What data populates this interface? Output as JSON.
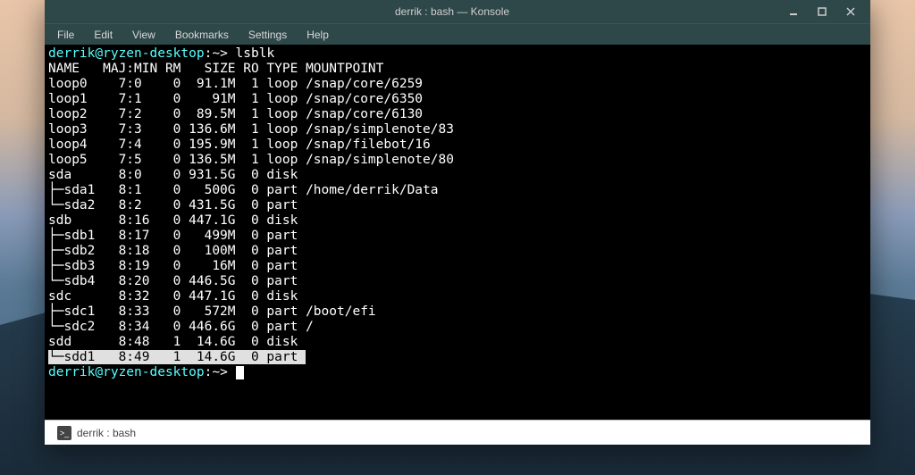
{
  "titlebar": {
    "title": "derrik : bash — Konsole"
  },
  "menubar": {
    "file": "File",
    "edit": "Edit",
    "view": "View",
    "bookmarks": "Bookmarks",
    "settings": "Settings",
    "help": "Help"
  },
  "terminal": {
    "prompt1_user": "derrik@ryzen-desktop",
    "prompt1_path": ":~>",
    "command1": " lsblk",
    "header": "NAME   MAJ:MIN RM   SIZE RO TYPE MOUNTPOINT",
    "lines": [
      "loop0    7:0    0  91.1M  1 loop /snap/core/6259",
      "loop1    7:1    0    91M  1 loop /snap/core/6350",
      "loop2    7:2    0  89.5M  1 loop /snap/core/6130",
      "loop3    7:3    0 136.6M  1 loop /snap/simplenote/83",
      "loop4    7:4    0 195.9M  1 loop /snap/filebot/16",
      "loop5    7:5    0 136.5M  1 loop /snap/simplenote/80",
      "sda      8:0    0 931.5G  0 disk ",
      "├─sda1   8:1    0   500G  0 part /home/derrik/Data",
      "└─sda2   8:2    0 431.5G  0 part ",
      "sdb      8:16   0 447.1G  0 disk ",
      "├─sdb1   8:17   0   499M  0 part ",
      "├─sdb2   8:18   0   100M  0 part ",
      "├─sdb3   8:19   0    16M  0 part ",
      "└─sdb4   8:20   0 446.5G  0 part ",
      "sdc      8:32   0 447.1G  0 disk ",
      "├─sdc1   8:33   0   572M  0 part /boot/efi",
      "└─sdc2   8:34   0 446.6G  0 part /",
      "sdd      8:48   1  14.6G  0 disk "
    ],
    "highlighted_line": "└─sdd1   8:49   1  14.6G  0 part ",
    "prompt2_user": "derrik@ryzen-desktop",
    "prompt2_path": ":~>"
  },
  "tab": {
    "label": "derrik : bash"
  }
}
